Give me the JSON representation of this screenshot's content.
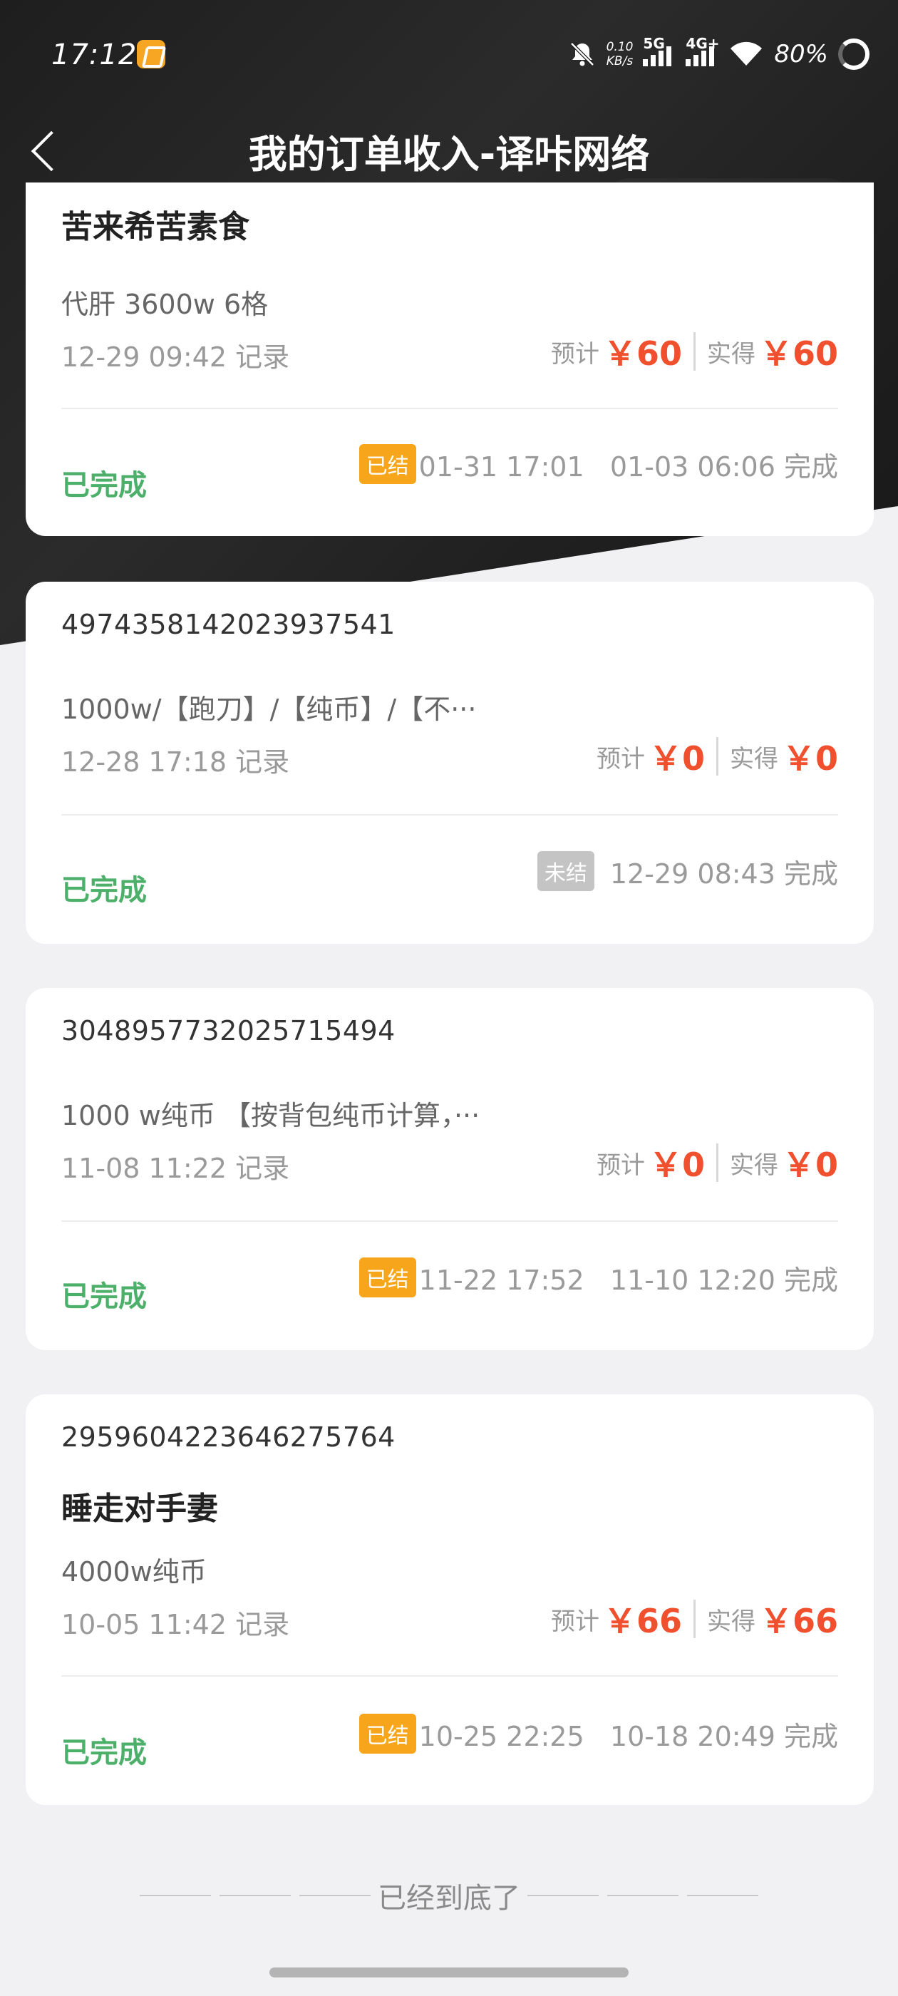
{
  "status_bar": {
    "time": "17:12",
    "speed_value": "0.10",
    "speed_unit": "KB/s",
    "net_5g": "5G",
    "net_4g": "4G+",
    "battery": "80%"
  },
  "header": {
    "title": "我的订单收入-译咔网络"
  },
  "orders": [
    {
      "name": "苦来希苦素食",
      "desc": "代肝 3600w 6格",
      "record": "12-29 09:42 记录",
      "est_label": "预计",
      "est_value": "￥60",
      "act_label": "实得",
      "act_value": "￥60",
      "status": "已完成",
      "badge": "已结",
      "foot": "01-31 17:01   01-03 06:06 完成"
    },
    {
      "id": "4974358142023937541",
      "desc": "1000w/【跑刀】/【纯币】/【不···",
      "record": "12-28 17:18 记录",
      "est_label": "预计",
      "est_value": "￥0",
      "act_label": "实得",
      "act_value": "￥0",
      "status": "已完成",
      "badge": "未结",
      "foot": "12-29 08:43 完成"
    },
    {
      "id": "3048957732025715494",
      "desc": "1000 w纯币 【按背包纯币计算，···",
      "record": "11-08 11:22 记录",
      "est_label": "预计",
      "est_value": "￥0",
      "act_label": "实得",
      "act_value": "￥0",
      "status": "已完成",
      "badge": "已结",
      "foot": "11-22 17:52   11-10 12:20 完成"
    },
    {
      "id": "2959604223646275764",
      "name": "睡走对手妻",
      "desc": "4000w纯币",
      "record": "10-05 11:42 记录",
      "est_label": "预计",
      "est_value": "￥66",
      "act_label": "实得",
      "act_value": "￥66",
      "status": "已完成",
      "badge": "已结",
      "foot": "10-25 22:25   10-18 20:49 完成"
    }
  ],
  "footer": {
    "end_text": "已经到底了"
  },
  "colors": {
    "accent_red": "#f0502e",
    "status_green": "#4caf6a",
    "badge_orange": "#f7a61c",
    "badge_gray": "#c4c4c4"
  }
}
